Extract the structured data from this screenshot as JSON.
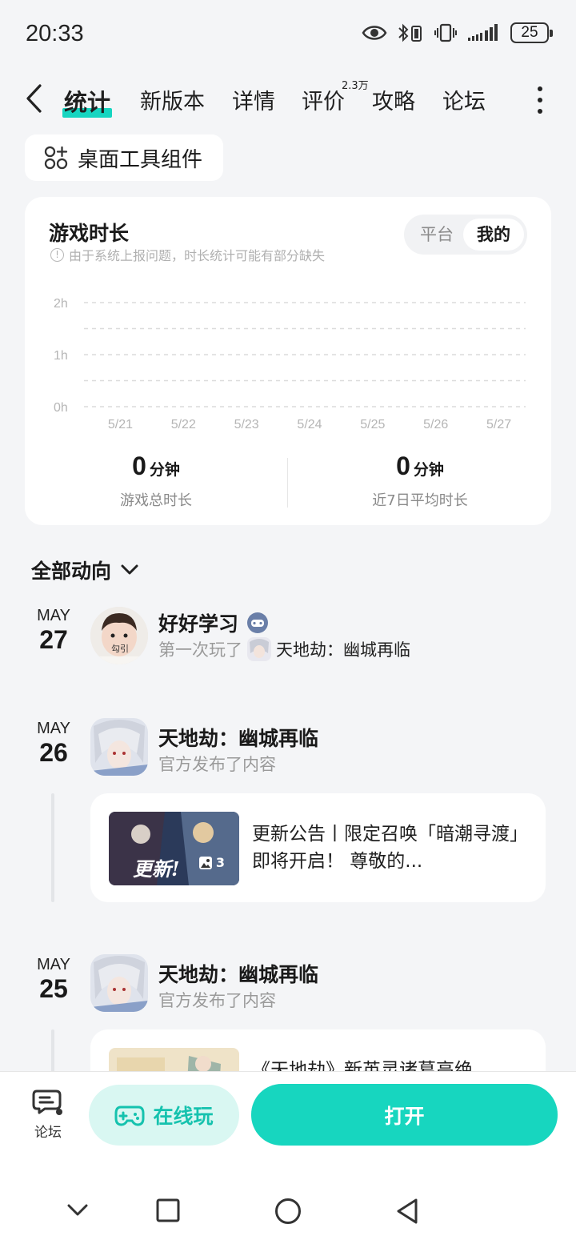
{
  "status": {
    "time": "20:33",
    "battery": "25"
  },
  "nav": {
    "tabs": [
      "统计",
      "新版本",
      "详情",
      "评价",
      "攻略",
      "论坛"
    ],
    "review_badge": "2.3万"
  },
  "widget_chip": "桌面工具组件",
  "stats": {
    "title": "游戏时长",
    "note": "由于系统上报问题，时长统计可能有部分缺失",
    "toggle": [
      "平台",
      "我的"
    ],
    "selected_toggle": "我的",
    "total_value": "0",
    "total_unit": "分钟",
    "total_label": "游戏总时长",
    "avg_value": "0",
    "avg_unit": "分钟",
    "avg_label": "近7日平均时长"
  },
  "chart_data": {
    "type": "bar",
    "categories": [
      "5/21",
      "5/22",
      "5/23",
      "5/24",
      "5/25",
      "5/26",
      "5/27"
    ],
    "values": [
      0,
      0,
      0,
      0,
      0,
      0,
      0
    ],
    "yticks": [
      "2h",
      "1h",
      "0h"
    ],
    "ylim": [
      0,
      2
    ],
    "grid": true
  },
  "feed": {
    "filter_label": "全部动向",
    "entries": [
      {
        "month": "MAY",
        "day": "27",
        "name": "好好学习",
        "sub": "第一次玩了",
        "game": "天地劫：幽城再临",
        "avatar_text": "勾引"
      },
      {
        "month": "MAY",
        "day": "26",
        "name": "天地劫：幽城再临",
        "sub": "官方发布了内容",
        "post": "更新公告丨限定召唤「暗潮寻渡」即将开启！ 尊敬的...",
        "thumb_text": "更新!",
        "image_count": "3"
      },
      {
        "month": "MAY",
        "day": "25",
        "name": "天地劫：幽城再临",
        "sub": "官方发布了内容",
        "post": "《天地劫》新英灵诸葛高绝"
      }
    ]
  },
  "bottom": {
    "forum_label": "论坛",
    "online_label": "在线玩",
    "open_label": "打开"
  },
  "colors": {
    "accent": "#17d6bf",
    "accent_light": "#d9f7f2"
  }
}
